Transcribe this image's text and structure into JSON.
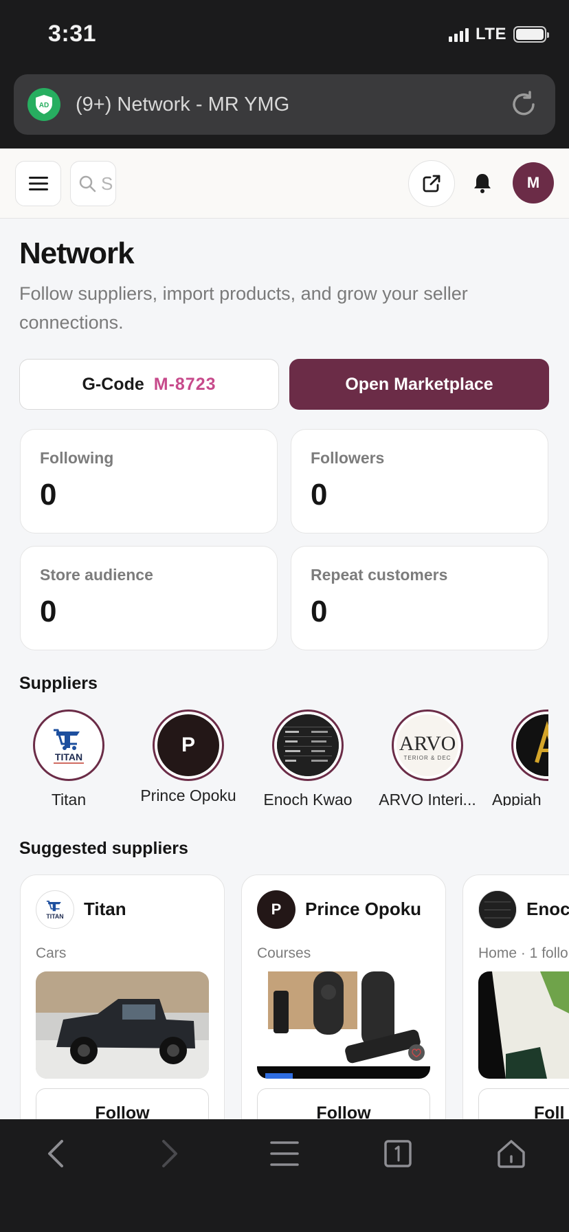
{
  "status_bar": {
    "time": "3:31",
    "network": "LTE"
  },
  "browser": {
    "url_title": "(9+) Network - MR YMG",
    "ad_badge": "AD"
  },
  "topnav": {
    "search_placeholder": "S",
    "avatar_initial": "M"
  },
  "header": {
    "title": "Network",
    "subtitle": "Follow suppliers, import products, and grow your seller connections."
  },
  "actions": {
    "gcode_label": "G-Code",
    "gcode_value": "M-8723",
    "marketplace_label": "Open Marketplace"
  },
  "stats": [
    {
      "label": "Following",
      "value": "0"
    },
    {
      "label": "Followers",
      "value": "0"
    },
    {
      "label": "Store audience",
      "value": "0"
    },
    {
      "label": "Repeat customers",
      "value": "0"
    }
  ],
  "suppliers": {
    "title": "Suppliers",
    "items": [
      {
        "name": "Titan"
      },
      {
        "name": "Prince Opoku",
        "initial": "P"
      },
      {
        "name": "Enoch Kwao"
      },
      {
        "name": "ARVO Interi..."
      },
      {
        "name": "Appiah"
      }
    ]
  },
  "suggested": {
    "title": "Suggested suppliers",
    "cards": [
      {
        "name": "Titan",
        "category": "Cars",
        "follow_label": "Follow"
      },
      {
        "name": "Prince Opoku",
        "initial": "P",
        "category": "Courses",
        "follow_label": "Follow"
      },
      {
        "name": "Enoc",
        "category": "Home · 1 follo",
        "follow_label": "Foll"
      }
    ]
  },
  "logo_text": {
    "titan": "TITAN",
    "arvo": "ARVO",
    "arvo_sub": "TERIOR & DEC"
  },
  "colors": {
    "brand": "#6b2c47",
    "accent": "#c74a8b"
  }
}
